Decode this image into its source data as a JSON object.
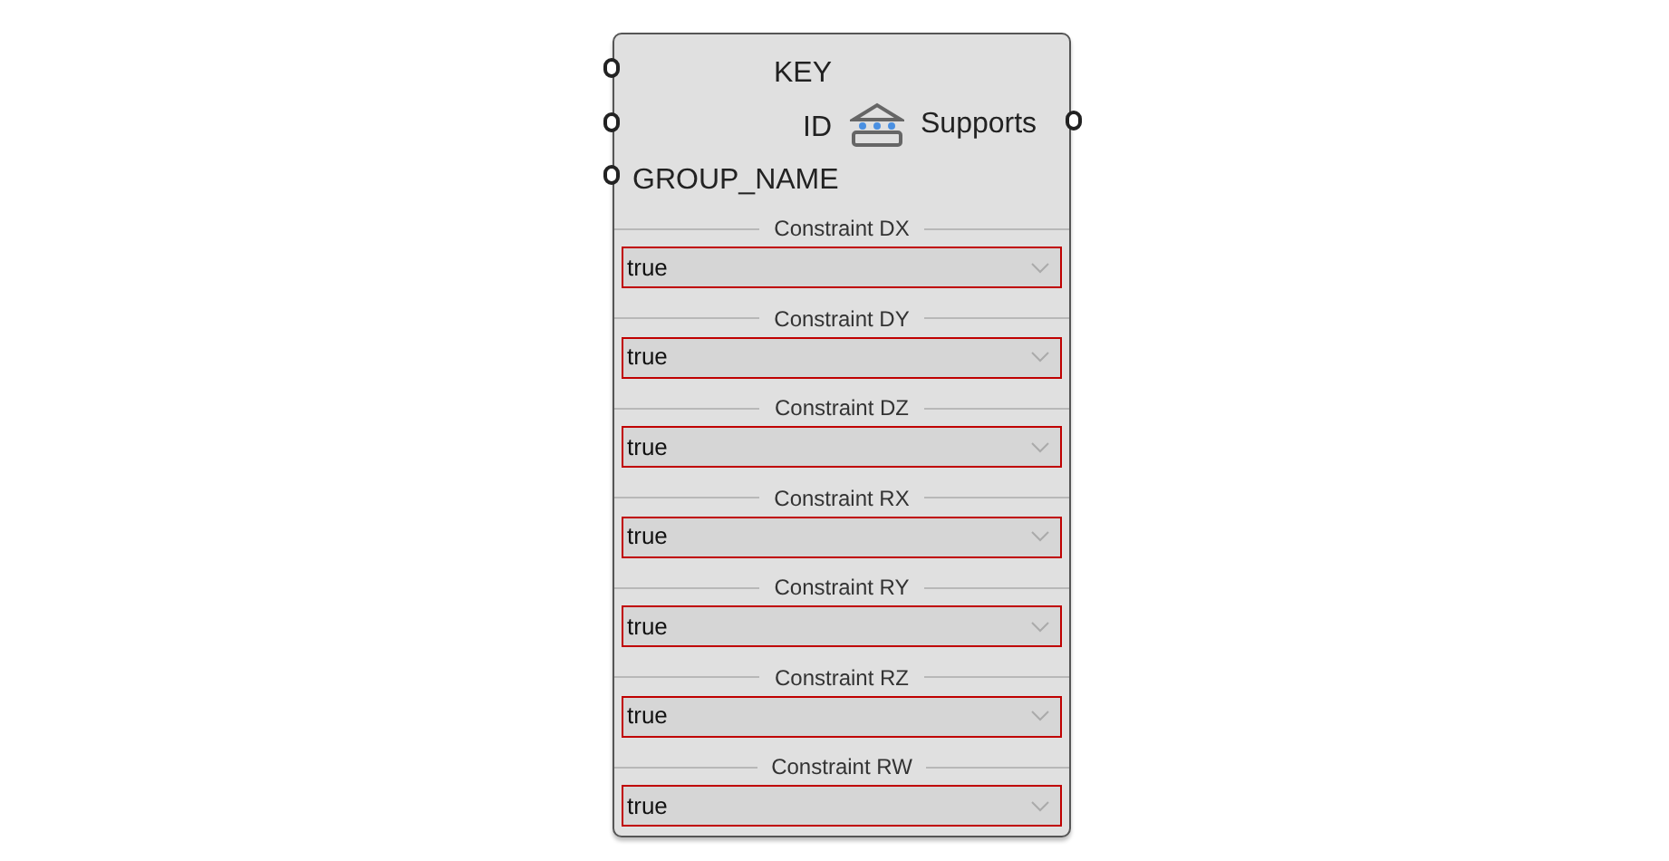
{
  "component": {
    "inputs": [
      "KEY",
      "ID",
      "GROUP_NAME"
    ],
    "output": "Supports",
    "constraints": [
      {
        "label": "Constraint DX",
        "value": "true"
      },
      {
        "label": "Constraint DY",
        "value": "true"
      },
      {
        "label": "Constraint DZ",
        "value": "true"
      },
      {
        "label": "Constraint RX",
        "value": "true"
      },
      {
        "label": "Constraint RY",
        "value": "true"
      },
      {
        "label": "Constraint RZ",
        "value": "true"
      },
      {
        "label": "Constraint RW",
        "value": "true"
      }
    ]
  }
}
